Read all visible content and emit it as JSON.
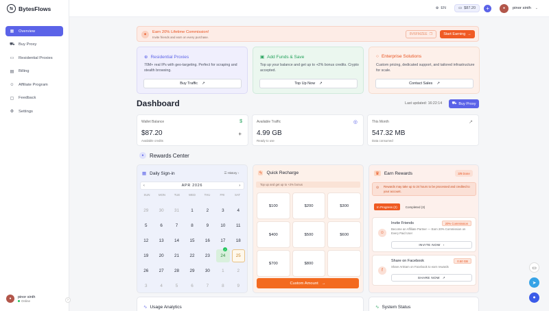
{
  "app": {
    "name": "BytesFlows"
  },
  "sidebar": {
    "items": [
      {
        "label": "Overview",
        "icon": "grid-icon"
      },
      {
        "label": "Buy Proxy",
        "icon": "cart-icon"
      },
      {
        "label": "Residential Proxies",
        "icon": "monitor-icon"
      },
      {
        "label": "Billing",
        "icon": "receipt-icon"
      },
      {
        "label": "Affiliate Program",
        "icon": "users-icon"
      },
      {
        "label": "Feedback",
        "icon": "message-icon"
      },
      {
        "label": "Settings",
        "icon": "gear-icon"
      }
    ],
    "user": {
      "name": "pinor sinth",
      "status": "Online"
    }
  },
  "topbar": {
    "lang": "EN",
    "balance": "$87.20",
    "user_name": "pinor sinth"
  },
  "promo": {
    "title": "Earn 20% Lifetime Commission!",
    "subtitle": "Invite friends and earn on every purchase.",
    "code": "8V6FMZEE",
    "button": "Start Earning"
  },
  "features": [
    {
      "title": "Residential Proxies",
      "desc": "70M+ real IPs with geo-targeting. Perfect for scraping and stealth browsing.",
      "button": "Buy Traffic",
      "color": "#5b63e8"
    },
    {
      "title": "Add Funds & Save",
      "desc": "Top up your balance and get up to +2% bonus credits. Crypto accepted.",
      "button": "Top Up Now",
      "color": "#22a15a"
    },
    {
      "title": "Enterprise Solutions",
      "desc": "Custom pricing, dedicated support, and tailored infrastructure for scale.",
      "button": "Contact Sales",
      "color": "#e8521f"
    }
  ],
  "dashboard": {
    "title": "Dashboard",
    "updated": "Last updated: 16:22:14",
    "buy_button": "Buy Proxy"
  },
  "stats": [
    {
      "label": "Wallet Balance",
      "value": "$87.20",
      "sub": "Available credits",
      "icon": "$"
    },
    {
      "label": "Available Traffic",
      "value": "4.99 GB",
      "sub": "Ready to use",
      "icon": "◎"
    },
    {
      "label": "This Month",
      "value": "547.32 MB",
      "sub": "Data consumed",
      "icon": "↗"
    }
  ],
  "rewards": {
    "title": "Rewards Center"
  },
  "calendar": {
    "title": "Daily Sign-in",
    "history": "History",
    "month": "APR 2026",
    "dows": [
      "SUN",
      "MON",
      "TUE",
      "WED",
      "THU",
      "FRI",
      "SAT"
    ],
    "days": [
      "29",
      "30",
      "31",
      "1",
      "2",
      "3",
      "4",
      "5",
      "6",
      "7",
      "8",
      "9",
      "10",
      "11",
      "12",
      "13",
      "14",
      "15",
      "16",
      "17",
      "18",
      "19",
      "20",
      "21",
      "22",
      "23",
      "24",
      "25",
      "26",
      "27",
      "28",
      "29",
      "30",
      "1",
      "2",
      "3",
      "4",
      "5",
      "6",
      "7",
      "8",
      "9"
    ]
  },
  "recharge": {
    "title": "Quick Recharge",
    "subtitle": "Top up and get up to +2% bonus",
    "amounts": [
      "$100",
      "$200",
      "$300",
      "$400",
      "$500",
      "$600",
      "$700",
      "$800",
      ""
    ],
    "custom": "Custom Amount"
  },
  "earn": {
    "title": "Earn Rewards",
    "done": "3/8 Done",
    "notice": "Rewards may take up to 24 hours to be processed and credited to your account.",
    "tab_progress": "In Progress (2)",
    "tab_completed": "Completed (3)",
    "tasks": [
      {
        "title": "Invite Friends",
        "badge": "20% Commission",
        "desc": "Become an Affiliate Partner — Earn 20% Commission on Every Paid User",
        "button": "INVITE NOW"
      },
      {
        "title": "Share on Facebook",
        "badge": "0.50 GB",
        "desc": "Share ArtSam on Facebook to earn rewards",
        "button": "SHARE NOW"
      }
    ]
  },
  "bottom": {
    "usage": "Usage Analytics",
    "system": "System Status"
  }
}
